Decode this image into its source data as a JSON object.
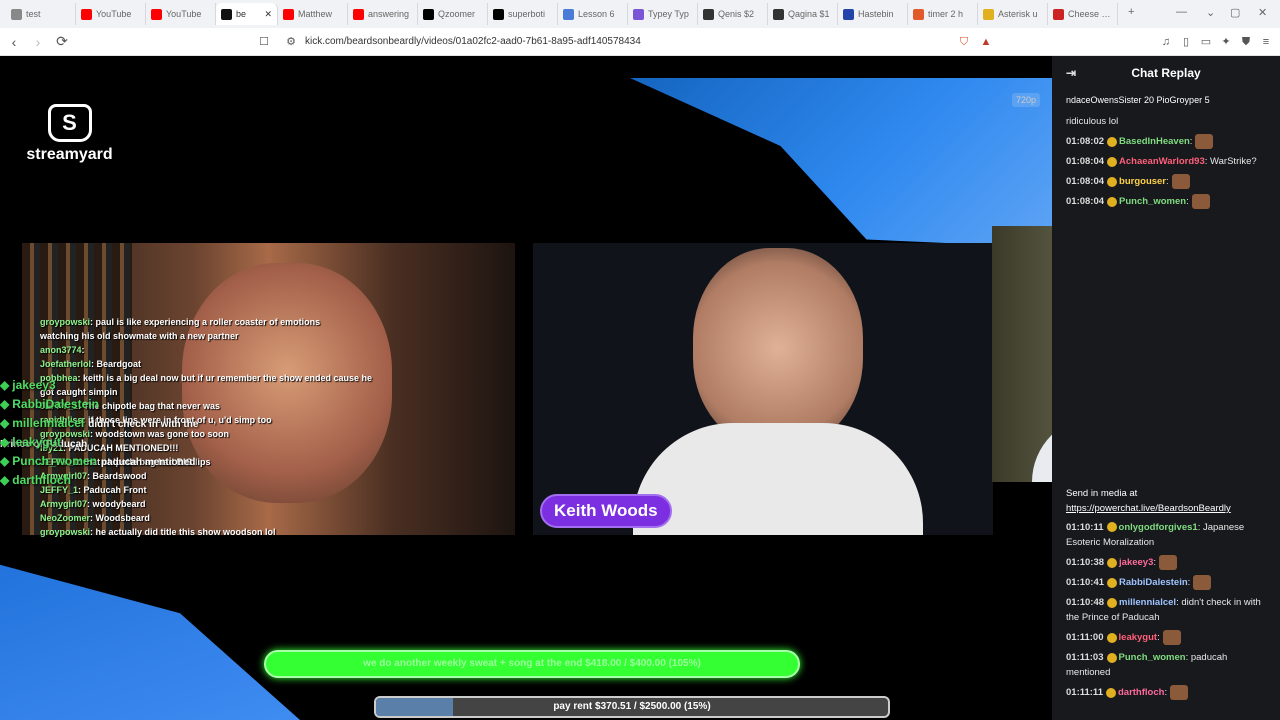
{
  "browser": {
    "tabs": [
      {
        "label": "test",
        "favicon": "globe-icon",
        "color": "#888888"
      },
      {
        "label": "YouTube",
        "favicon": "youtube-icon",
        "color": "#ff0000"
      },
      {
        "label": "YouTube",
        "favicon": "youtube-icon",
        "color": "#ff0000"
      },
      {
        "label": "be",
        "favicon": "kick-icon",
        "color": "#111111",
        "active": true
      },
      {
        "label": "Matthew",
        "favicon": "youtube-icon",
        "color": "#ff0000"
      },
      {
        "label": "answering",
        "favicon": "youtube-icon",
        "color": "#ff0000"
      },
      {
        "label": "Qzoomer",
        "favicon": "x-icon",
        "color": "#000000"
      },
      {
        "label": "superboti",
        "favicon": "x-icon",
        "color": "#000000"
      },
      {
        "label": "Lesson 6",
        "favicon": "doc-icon",
        "color": "#4a7bd6"
      },
      {
        "label": "Typey Typ",
        "favicon": "typey-icon",
        "color": "#7a55d6"
      },
      {
        "label": "Qenis $2",
        "favicon": "app-icon",
        "color": "#333333"
      },
      {
        "label": "Qagina $1",
        "favicon": "app-icon",
        "color": "#333333"
      },
      {
        "label": "Hastebin",
        "favicon": "hastebin-icon",
        "color": "#2244aa"
      },
      {
        "label": "timer 2 h",
        "favicon": "timer-icon",
        "color": "#e05a2a"
      },
      {
        "label": "Asterisk u",
        "favicon": "asterisk-icon",
        "color": "#e0b020"
      },
      {
        "label": "Cheese Ch",
        "favicon": "cheese-icon",
        "color": "#cc2222"
      }
    ],
    "url": "kick.com/beardsonbeardly/videos/01a02fc2-aad0-7b61-8a95-adf140578434"
  },
  "video": {
    "quality": "720p",
    "logo_text": "streamyard",
    "nameplate": "Keith Woods",
    "overlay_chat": [
      {
        "user": "groypowski",
        "text": ": paul is like experiencing a roller coaster of emotions"
      },
      {
        "user": "",
        "text": "watching his old showmate with a new partner"
      },
      {
        "user": "anon3774",
        "text": ":"
      },
      {
        "user": "Joefatherlol",
        "text": ": Beardgoat"
      },
      {
        "user": "pobbhea",
        "text": ": keith is a big deal now but if ur remember the show ended cause he"
      },
      {
        "user": "",
        "text": "got caught simpin"
      },
      {
        "user": "JEFFY_1",
        "text": ": The chipotle bag that never was"
      },
      {
        "user": "",
        "text": ""
      },
      {
        "user": "rapidbliss",
        "text": ": if those lips were in front of u, u'd simp too"
      },
      {
        "user": "groypowski",
        "text": ": woodstown was gone too soon"
      },
      {
        "user": "Iby21",
        "text": ": PADUCAH MENTIONED!!!"
      },
      {
        "user": "JEFFY_1",
        "text": ": that chipotle bag had BIG lips"
      },
      {
        "user": "Armygirl07",
        "text": ": Beardswood"
      },
      {
        "user": "JEFFY_1",
        "text": ": Paducah Front"
      },
      {
        "user": "Armygirl07",
        "text": ": woodybeard"
      },
      {
        "user": "NeoZoomer",
        "text": ": Woodsbeard"
      },
      {
        "user": "groypowski",
        "text": ": he actually did title this show woodson lol"
      }
    ],
    "overlay_left": [
      {
        "user": "jakeey3"
      },
      {
        "user": "RabbiDalestein"
      },
      {
        "user": "millennialcel",
        "text": "didn't check in with the Prince of Paducah"
      },
      {
        "user": "leakygut"
      },
      {
        "user": "Punch_women",
        "text": "paducah mentioned"
      },
      {
        "user": "darthfloch"
      }
    ],
    "goal_weekly": {
      "text": "we do another weekly sweat + song at the end $418.00 / $400.00 (105%)"
    },
    "goal_rent": {
      "text": "pay rent $370.51 / $2500.00 (15%)",
      "progress": 0.15
    }
  },
  "chat": {
    "title": "Chat Replay",
    "pinned_text": "ndaceOwensSister 20   PioGroyper 5",
    "messages_top": [
      {
        "time": "",
        "user": "",
        "text": "ridiculous lol",
        "color": "#ffffff"
      },
      {
        "time": "01:08:02",
        "user": "BasedInHeaven",
        "text": ":",
        "color": "#7fdc7f"
      },
      {
        "time": "01:08:04",
        "user": "AchaeanWarlord93",
        "text": ": WarStrike?",
        "color": "#ff5f7a"
      },
      {
        "time": "01:08:04",
        "user": "burgouser",
        "text": ":",
        "color": "#ffd24a"
      },
      {
        "time": "01:08:04",
        "user": "Punch_women",
        "text": ":",
        "color": "#7fdc7f"
      }
    ],
    "media_line": "Send in media at",
    "media_link": "https://powerchat.live/BeardsonBeardly",
    "messages_bottom": [
      {
        "time": "01:10:11",
        "user": "onlygodforgives1",
        "text": ": Japanese Esoteric Moralization",
        "color": "#7fdc7f"
      },
      {
        "time": "01:10:38",
        "user": "jakeey3",
        "text": ":",
        "color": "#ff6b9a"
      },
      {
        "time": "01:10:41",
        "user": "RabbiDalestein",
        "text": ":",
        "color": "#9ec4ff"
      },
      {
        "time": "01:10:48",
        "user": "millennialcel",
        "text": ": didn't check in with the Prince of Paducah",
        "color": "#9ec4ff"
      },
      {
        "time": "01:11:00",
        "user": "leakygut",
        "text": ":",
        "color": "#ff5f7a"
      },
      {
        "time": "01:11:03",
        "user": "Punch_women",
        "text": ": paducah mentioned",
        "color": "#7fdc7f"
      },
      {
        "time": "01:11:11",
        "user": "darthfloch",
        "text": ":",
        "color": "#ff6b9a"
      }
    ]
  }
}
